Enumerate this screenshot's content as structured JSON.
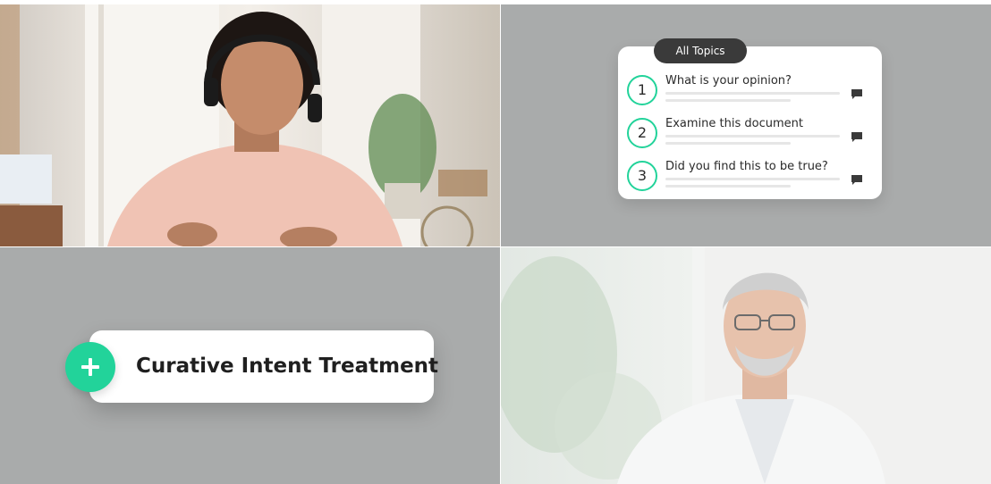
{
  "topics_panel": {
    "pill_label": "All Topics",
    "items": [
      {
        "number": "1",
        "title": "What is your opinion?"
      },
      {
        "number": "2",
        "title": "Examine this document"
      },
      {
        "number": "3",
        "title": "Did you find this to be true?"
      }
    ]
  },
  "treatment_badge": {
    "label": "Curative Intent Treatment"
  },
  "colors": {
    "accent": "#22d39a",
    "tile_gray": "#a9abab",
    "pill": "#3a3a3a"
  }
}
